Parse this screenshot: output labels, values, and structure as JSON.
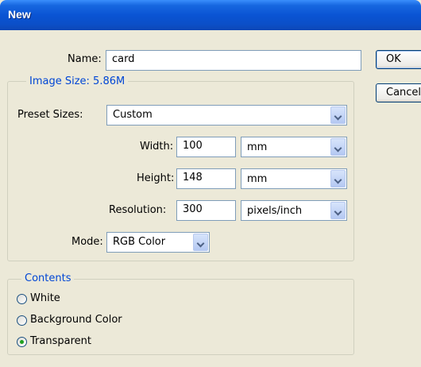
{
  "window": {
    "title": "New"
  },
  "form": {
    "name_label": "Name:",
    "name_value": "card",
    "image_size_label": "Image Size: 5.86M",
    "preset_label": "Preset Sizes:",
    "preset_value": "Custom",
    "width_label": "Width:",
    "width_value": "100",
    "width_unit": "mm",
    "height_label": "Height:",
    "height_value": "148",
    "height_unit": "mm",
    "resolution_label": "Resolution:",
    "resolution_value": "300",
    "resolution_unit": "pixels/inch",
    "mode_label": "Mode:",
    "mode_value": "RGB Color"
  },
  "contents": {
    "legend": "Contents",
    "options": [
      {
        "label": "White",
        "selected": false
      },
      {
        "label": "Background Color",
        "selected": false
      },
      {
        "label": "Transparent",
        "selected": true
      }
    ]
  },
  "buttons": {
    "ok": "OK",
    "cancel": "Cancel"
  },
  "icons": [
    "chevron-down-icon",
    "radio-button-icon"
  ]
}
